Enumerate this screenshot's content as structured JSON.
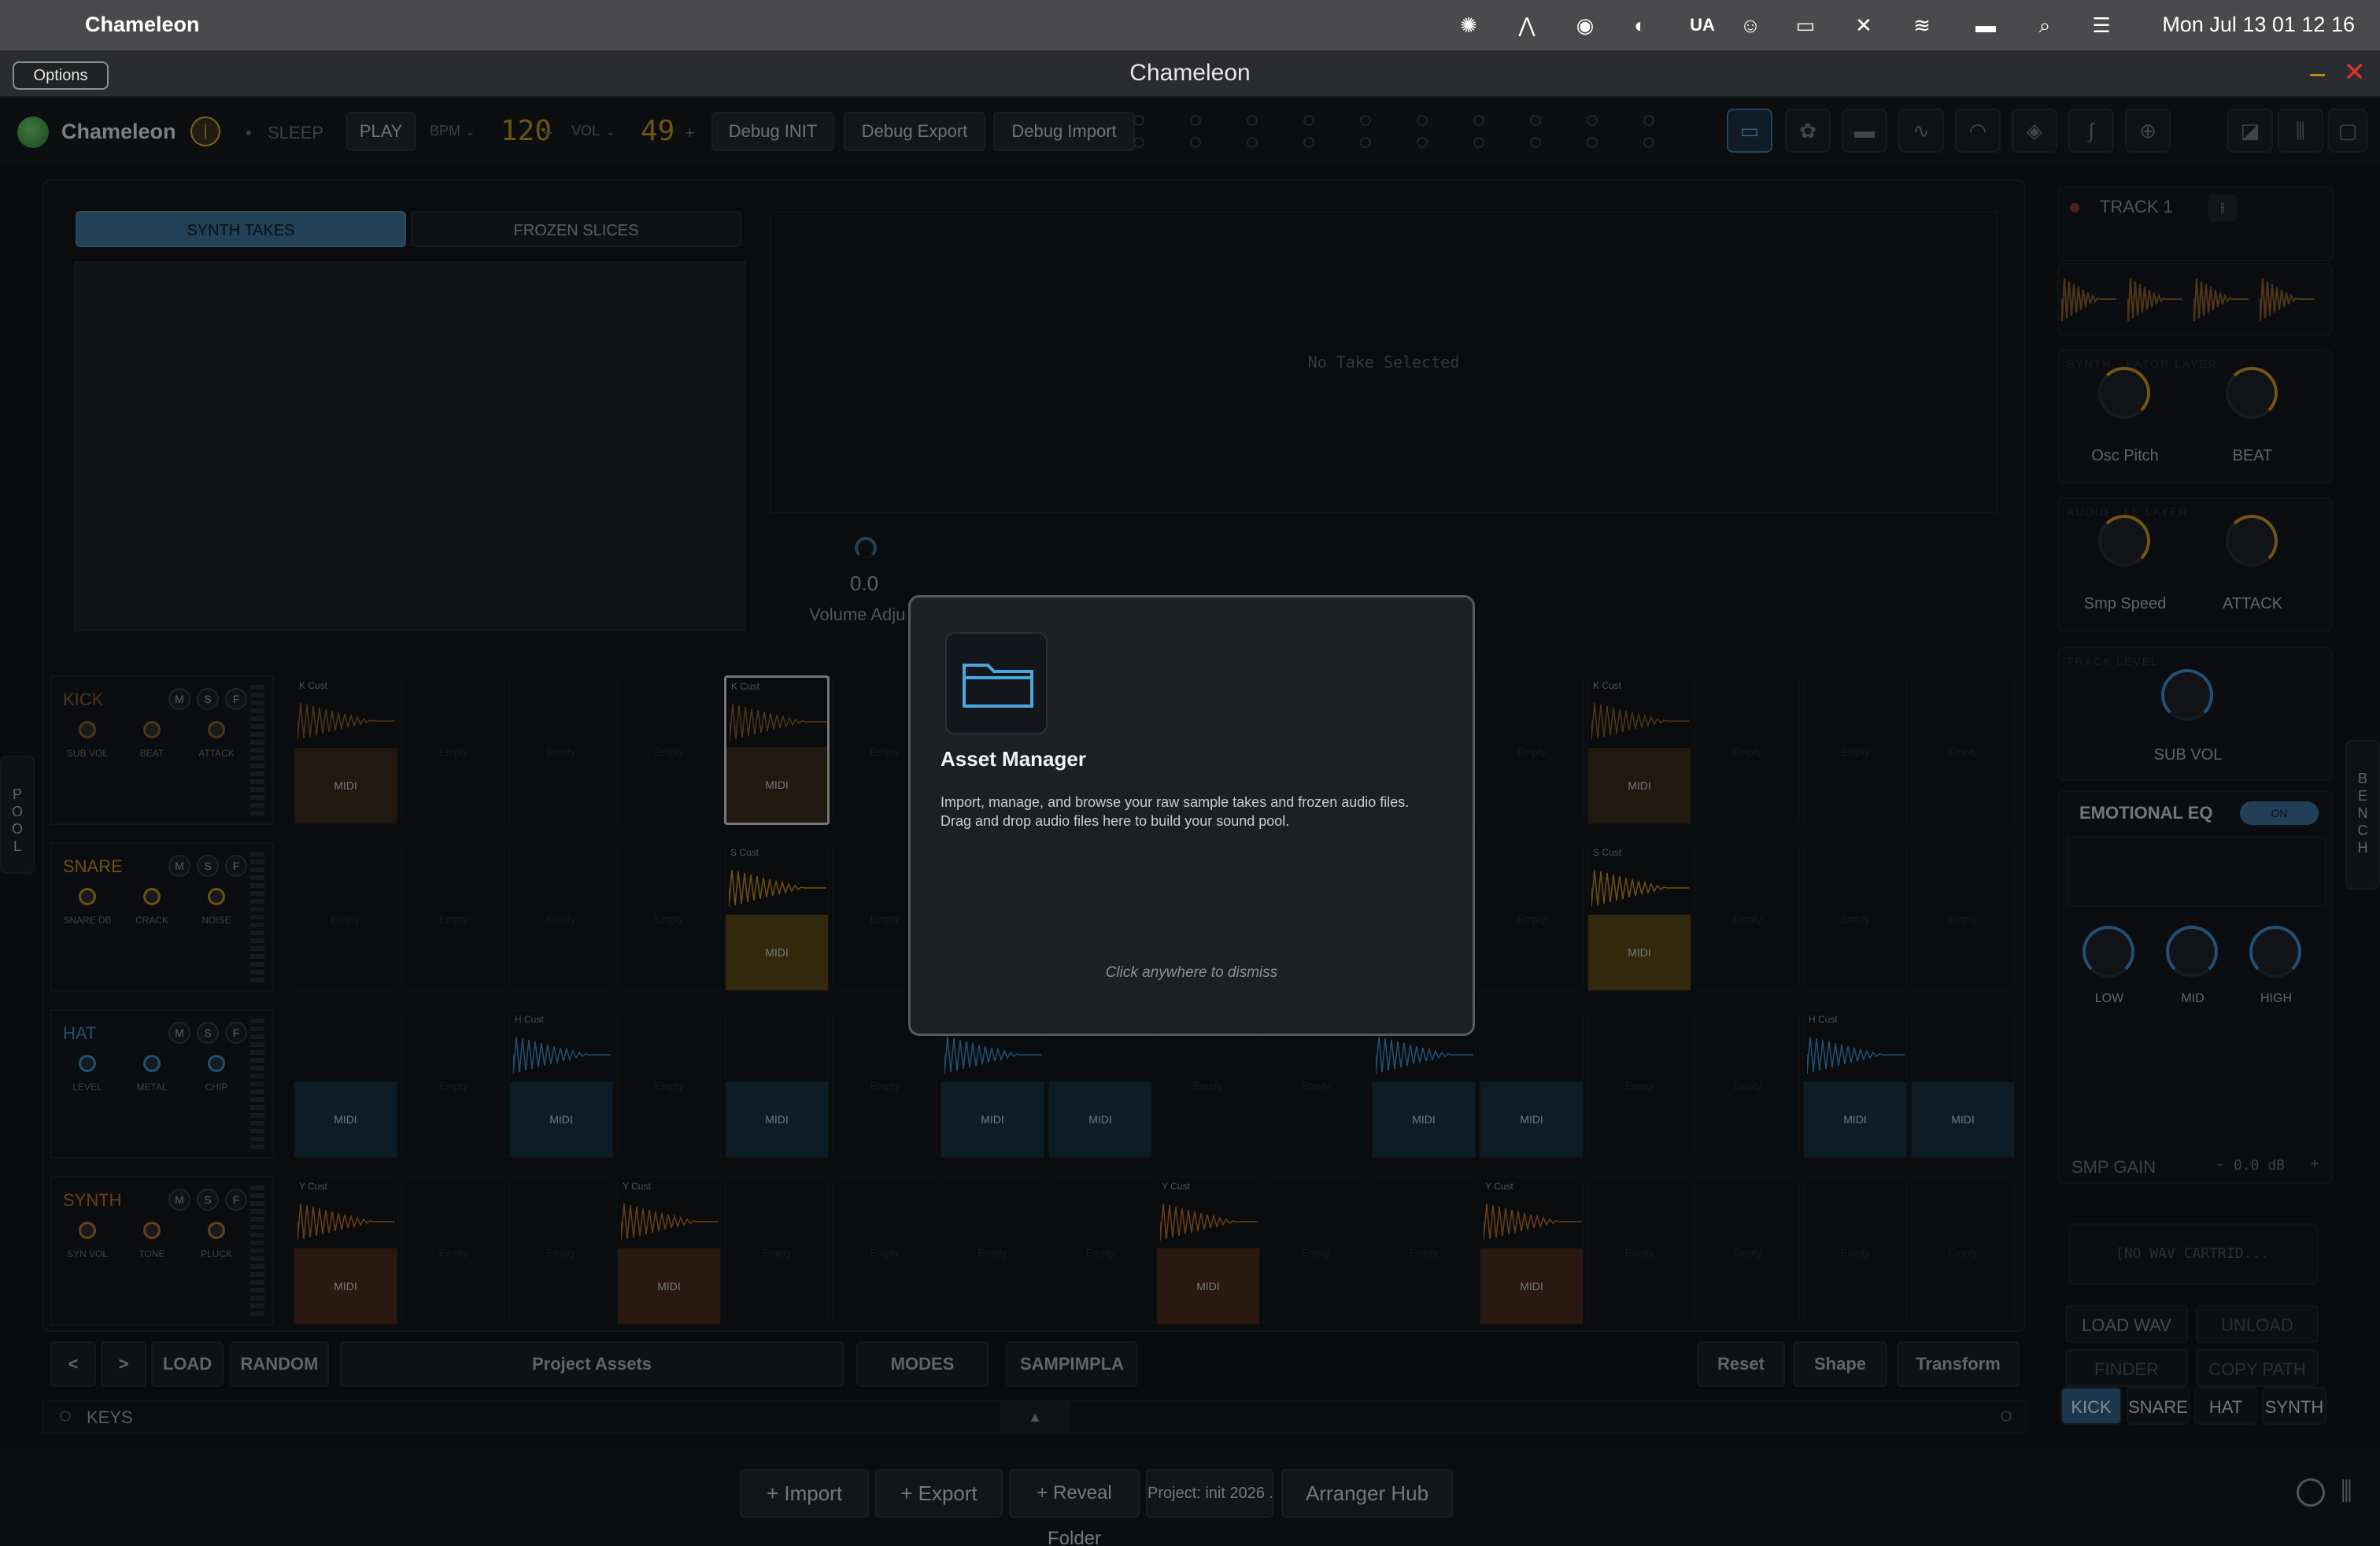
{
  "menubar": {
    "app_name": "Chameleon",
    "locale": "UA",
    "clock": "Mon Jul 13  01 12 16",
    "icons": [
      "openai-icon",
      "a-icon",
      "cloud-icon",
      "contrast-icon",
      "ua-label",
      "user-icon",
      "display-icon",
      "mute-icon",
      "wifi-icon",
      "battery-icon",
      "search-icon",
      "control-center-icon"
    ]
  },
  "window": {
    "title": "Chameleon",
    "options_label": "Options"
  },
  "toolbar": {
    "brand": "Chameleon",
    "sleep_label": "SLEEP",
    "play_label": "PLAY",
    "bpm_label": "BPM",
    "bpm_value": "120",
    "vol_label": "VOL",
    "vol_value": "49",
    "minus": "-",
    "plus": "+",
    "debug_init": "Debug INIT",
    "debug_export": "Debug Export",
    "debug_import": "Debug Import"
  },
  "main": {
    "tabs": [
      {
        "label": "SYNTH TAKES",
        "active": true
      },
      {
        "label": "FROZEN SLICES",
        "active": false
      }
    ],
    "no_take": "No Take Selected",
    "volume_value": "0.0",
    "volume_label": "Volume Adju"
  },
  "tracks": [
    {
      "name": "KICK",
      "color": "#8a5a2a",
      "knobs": [
        "SUB VOL",
        "BEAT",
        "ATTACK"
      ]
    },
    {
      "name": "SNARE",
      "color": "#c08a20",
      "knobs": [
        "SNARE DB",
        "CRACK",
        "NOISE"
      ]
    },
    {
      "name": "HAT",
      "color": "#3a8ac8",
      "knobs": [
        "LEVEL",
        "METAL",
        "CHIP"
      ]
    },
    {
      "name": "SYNTH",
      "color": "#b86a2a",
      "knobs": [
        "SYN VOL",
        "TONE",
        "PLUCK"
      ]
    }
  ],
  "msf": [
    "M",
    "S",
    "F"
  ],
  "cells": {
    "empty": "Empty",
    "midi": "MIDI",
    "kick_tag": "K Cust",
    "snare_tag": "S Cust",
    "hat_tag": "H Cust",
    "synth_tag": "Y Cust"
  },
  "bottom": {
    "prev": "<",
    "next": ">",
    "load": "LOAD",
    "random": "RANDOM",
    "project_assets": "Project Assets",
    "modes": "MODES",
    "sampimpla": "SAMPIMPLA",
    "reset": "Reset",
    "shape": "Shape",
    "transform": "Transform",
    "keys": "KEYS",
    "collapse_arrow": "▲"
  },
  "footer": {
    "import": "+ Import",
    "export": "+ Export",
    "reveal": "+ Reveal Folder",
    "project": "Project: init 2026 ...",
    "arranger": "Arranger Hub"
  },
  "side": {
    "left_tab": "POOL",
    "right_tab": "BENCH"
  },
  "right_panel": {
    "track_label": "TRACK 1",
    "osc_pitch": "Osc Pitch",
    "beat": "BEAT",
    "smp_speed": "Smp Speed",
    "attack": "ATTACK",
    "sub_vol": "SUB VOL",
    "emotional_eq": "EMOTIONAL EQ",
    "eq_toggle": "ON",
    "low": "LOW",
    "mid": "MID",
    "high": "HIGH",
    "smp_gain": "SMP GAIN",
    "gain_value": "0.0 dB",
    "minus": "-",
    "plus": "+",
    "cartridge": "[NO WAV CARTRID...",
    "load_wav": "LOAD WAV",
    "unload": "UNLOAD",
    "finder": "FINDER",
    "copy_path": "COPY PATH",
    "track_tabs": [
      "KICK",
      "SNARE",
      "HAT",
      "SYNTH"
    ]
  },
  "modal": {
    "title": "Asset Manager",
    "description_line1": "Import, manage, and browse your raw sample takes and frozen audio files.",
    "description_line2": "Drag and drop audio files here to build your sound pool.",
    "dismiss_hint": "Click anywhere to dismiss",
    "icon": "folder-icon"
  },
  "colors": {
    "accent": "#3c6f94",
    "kick": "#8a5a2a",
    "snare": "#c08a20",
    "hat": "#3a8ac8",
    "synth": "#b86a2a"
  }
}
